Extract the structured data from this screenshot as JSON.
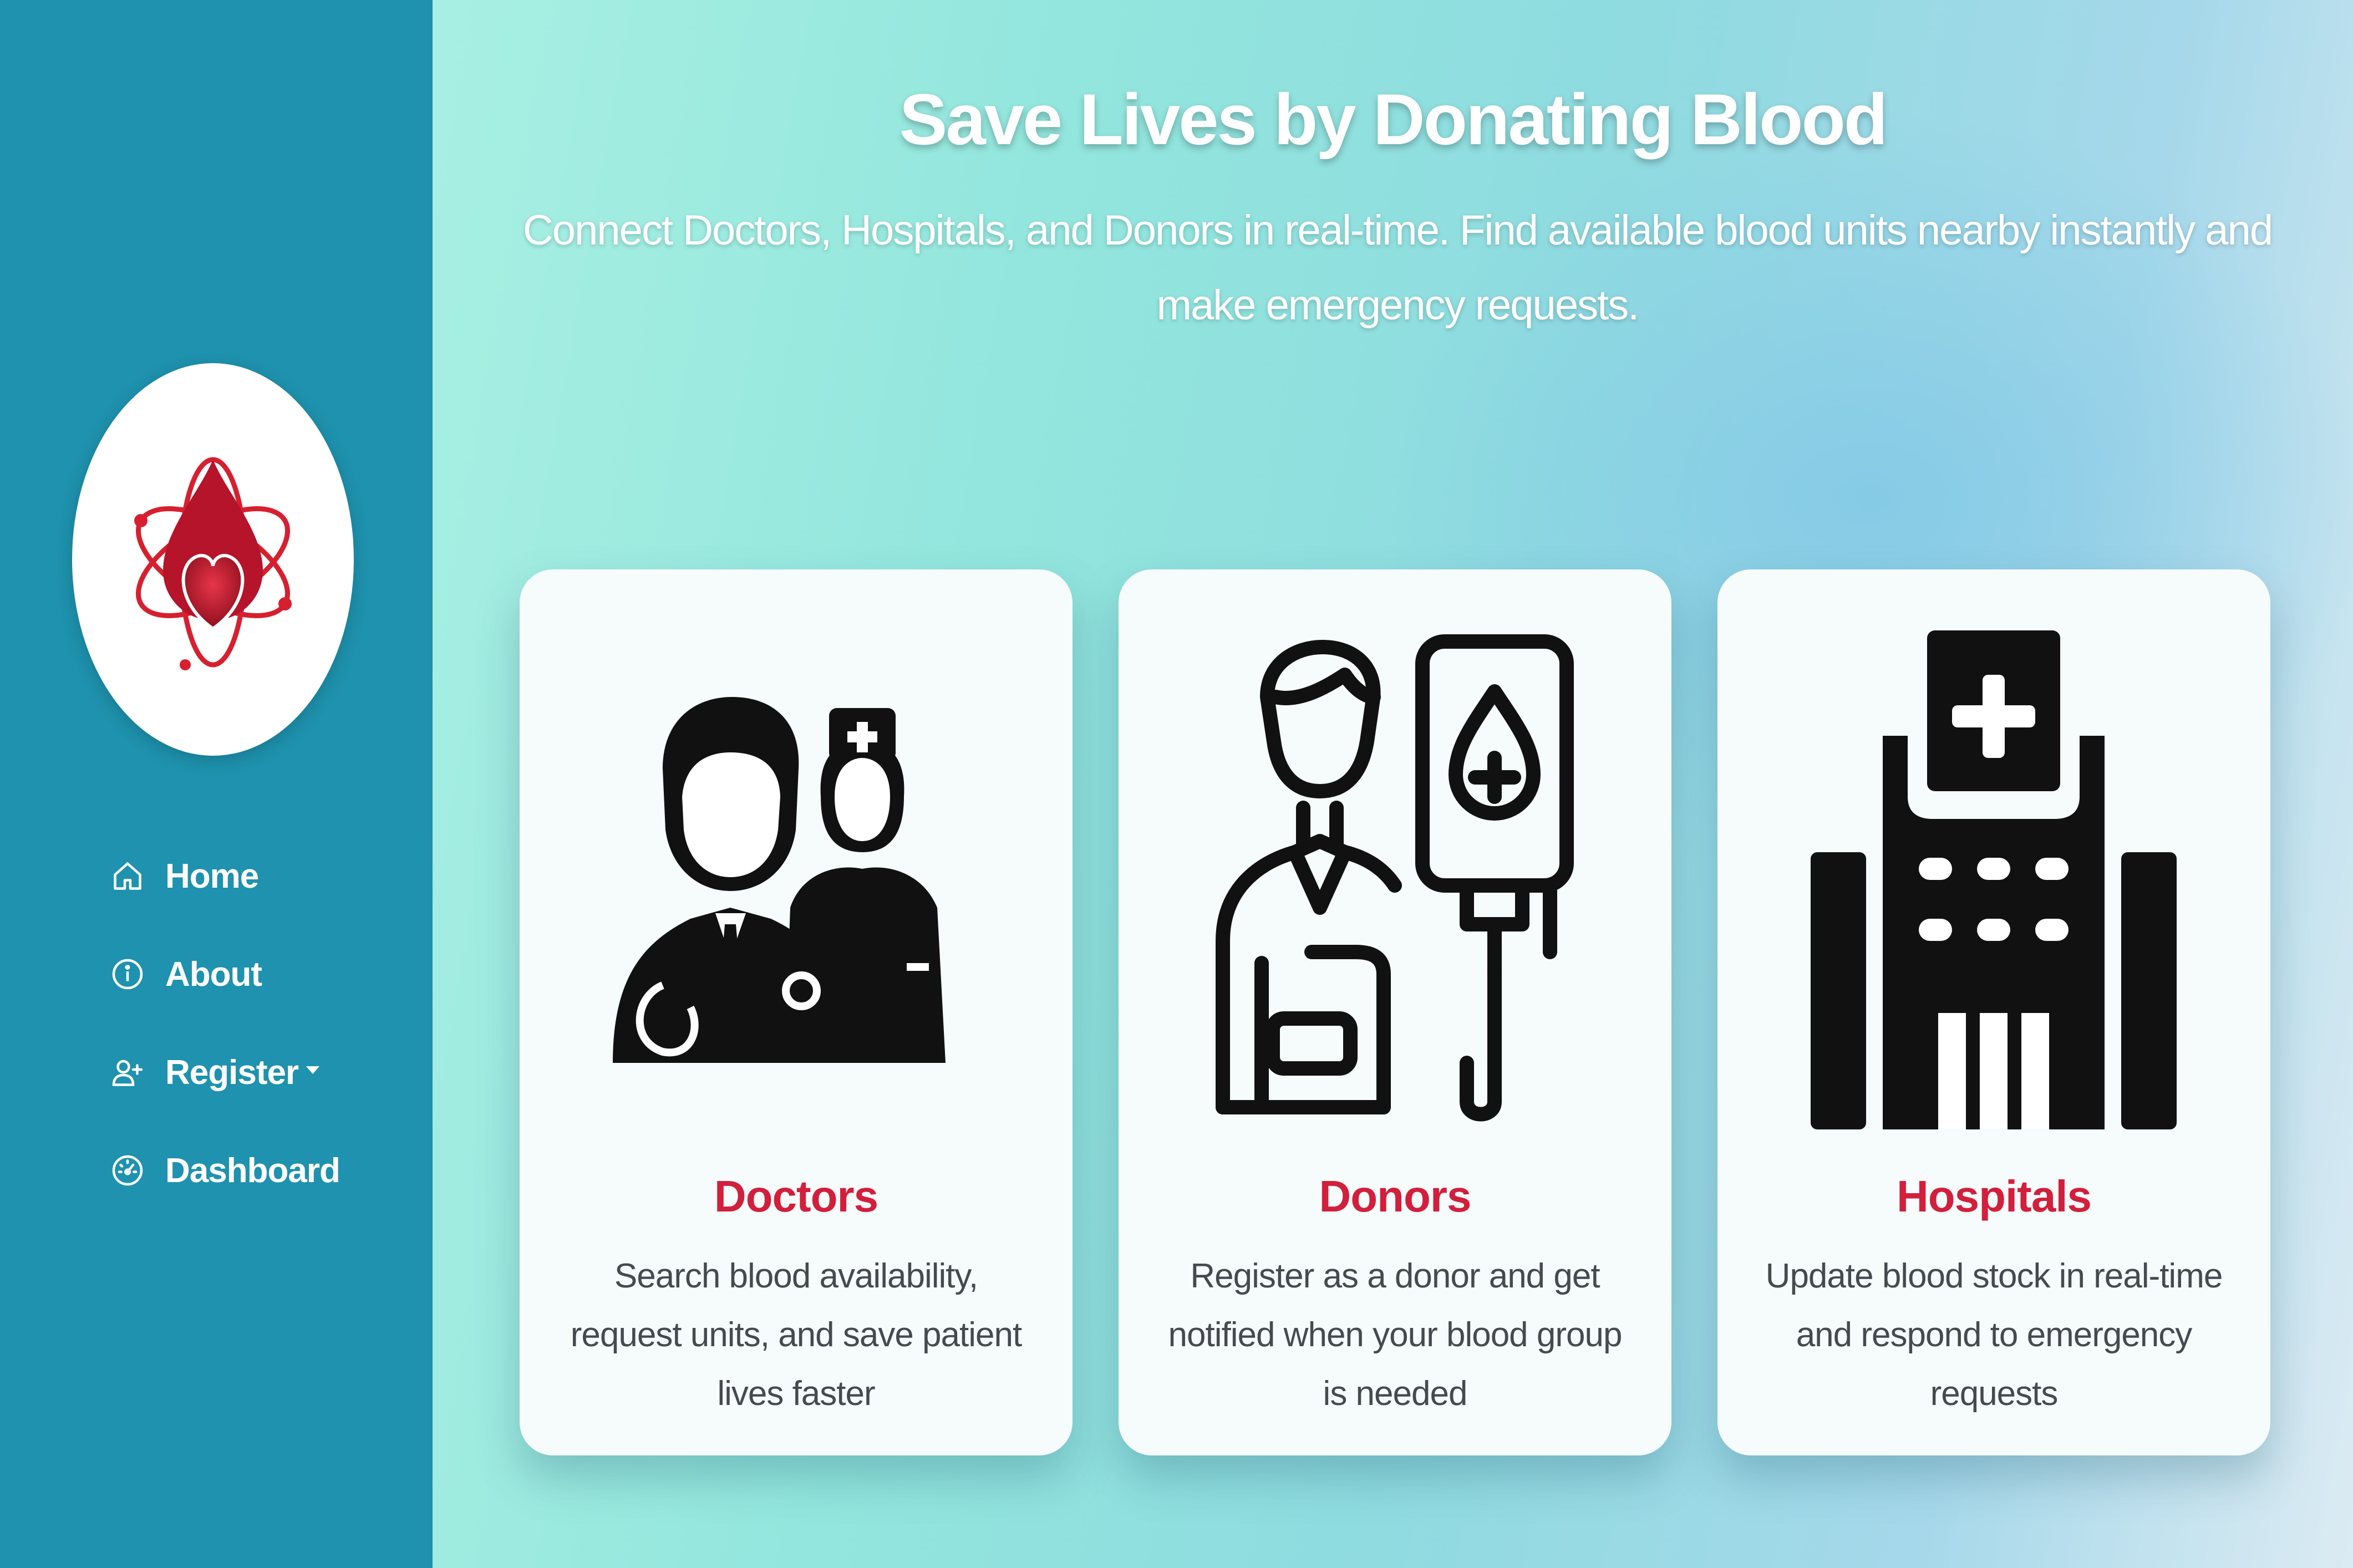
{
  "sidebar": {
    "logo_icon": "blood-drop-heart-atom-logo-icon",
    "nav": [
      {
        "label": "Home",
        "icon": "home-icon"
      },
      {
        "label": "About",
        "icon": "info-icon"
      },
      {
        "label": "Register",
        "icon": "add-user-icon",
        "has_dropdown": true
      },
      {
        "label": "Dashboard",
        "icon": "speedometer-icon"
      }
    ],
    "background_color": "#1e92ae"
  },
  "hero": {
    "title": "Save Lives by Donating Blood",
    "subtitle": "Connect Doctors, Hospitals, and Donors in real-time. Find available blood units nearby instantly and make emergency requests."
  },
  "cards": [
    {
      "title": "Doctors",
      "description": "Search blood availability, request units, and save patient lives faster",
      "icon": "doctor-and-nurse-icon"
    },
    {
      "title": "Donors",
      "description": "Register as a donor and get notified when your blood group is needed",
      "icon": "blood-donor-iv-bag-icon"
    },
    {
      "title": "Hospitals",
      "description": "Update blood stock in real-time and respond to emergency requests",
      "icon": "hospital-building-icon"
    }
  ],
  "colors": {
    "accent_red": "#d21f3c",
    "sidebar_teal": "#1e92ae",
    "card_bg": "#f6fbfb"
  }
}
